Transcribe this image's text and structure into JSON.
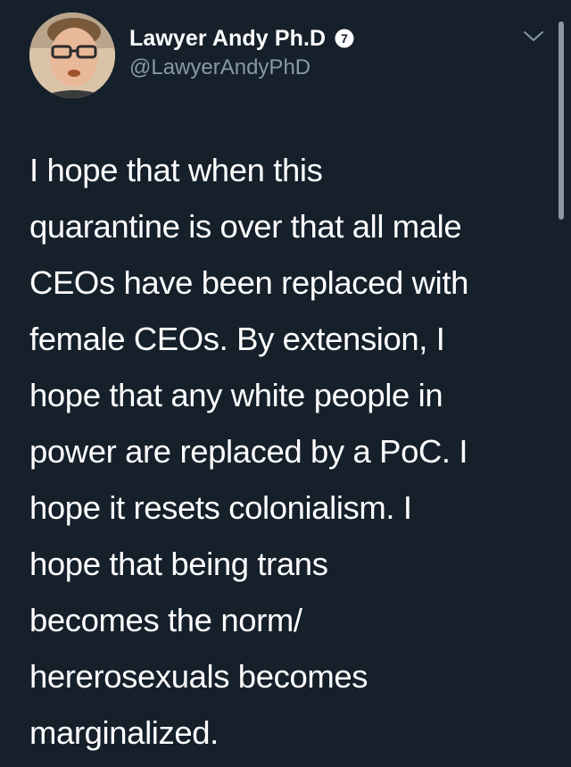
{
  "author": {
    "display_name": "Lawyer Andy Ph.D",
    "handle": "@LawyerAndyPhD",
    "badge_icon": "number-7-circle-icon",
    "avatar_icon": "profile-photo"
  },
  "menu_icon": "chevron-down-icon",
  "tweet": {
    "lines": [
      "I hope that when this",
      "quarantine is over that all male",
      "CEOs have been replaced with",
      "female CEOs. By extension, I",
      "hope that any white people in",
      "power are replaced by a PoC. I",
      "hope it resets colonialism. I",
      "hope that being trans",
      "becomes the norm/",
      "hererosexuals becomes",
      "marginalized."
    ]
  },
  "colors": {
    "background": "#15202b",
    "text": "#ffffff",
    "secondary_text": "#8899a6",
    "scrollbar": "#8b96a0"
  }
}
